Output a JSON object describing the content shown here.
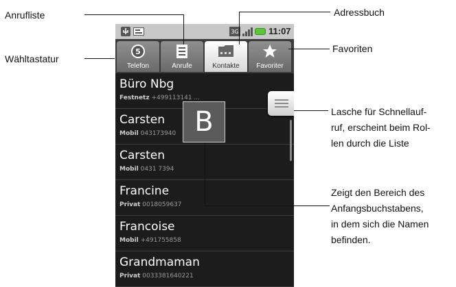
{
  "annotations": {
    "anrufliste": "Anrufliste",
    "waehltastatur": "Wähltastatur",
    "adressbuch": "Adressbuch",
    "favoriten": "Favoriten",
    "lasche": [
      "Lasche für Schnellauf-",
      "ruf, erscheint beim Rol-",
      "len durch die Liste"
    ],
    "bereich": [
      "Zeigt den Bereich des",
      "Anfangsbuchstabens,",
      "in dem sich die Namen",
      "befinden."
    ]
  },
  "status_bar": {
    "time": "11:07",
    "network": "3G"
  },
  "tabs": [
    {
      "label": "Telefon",
      "icon": "phone-dial-icon",
      "active": false
    },
    {
      "label": "Anrufe",
      "icon": "call-log-icon",
      "active": false
    },
    {
      "label": "Kontakte",
      "icon": "contacts-folder-icon",
      "active": true
    },
    {
      "label": "Favoriter",
      "icon": "star-icon",
      "active": false
    }
  ],
  "contacts": [
    {
      "name": "Büro Nbg",
      "type": "Festnetz",
      "number": "+499113141 ..."
    },
    {
      "name": "Carsten",
      "type": "Mobil",
      "number": "043173940"
    },
    {
      "name": "Carsten",
      "type": "Mobil",
      "number": "0431 7394"
    },
    {
      "name": "Francine",
      "type": "Privat",
      "number": "0018059637"
    },
    {
      "name": "Francoise",
      "type": "Mobil",
      "number": "+491755858"
    },
    {
      "name": "Grandmaman",
      "type": "Privat",
      "number": "0033381640221"
    }
  ],
  "fastscroll_letter": "B",
  "colors": {
    "battery": "#5cc53a",
    "list_bg": "#1c1c1c"
  }
}
